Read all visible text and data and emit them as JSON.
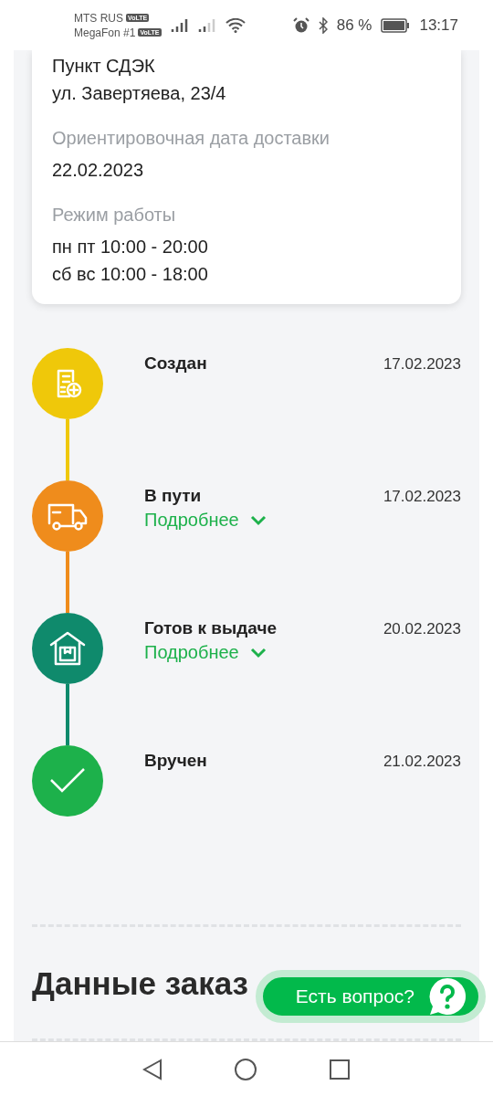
{
  "status_bar": {
    "carriers": [
      {
        "name": "MTS RUS",
        "badge": "VoLTE"
      },
      {
        "name": "MegaFon #1",
        "badge": "VoLTE"
      }
    ],
    "battery": "86 %",
    "time": "13:17"
  },
  "pickup_card": {
    "point": "Пункт СДЭК",
    "address": "ул. Завертяева, 23/4",
    "fields": [
      {
        "label": "Ориентировочная дата доставки",
        "lines": [
          "22.02.2023"
        ]
      },
      {
        "label": "Режим работы",
        "lines": [
          "пн пт 10:00 - 20:00",
          "сб вс 10:00 - 18:00"
        ]
      }
    ]
  },
  "timeline": [
    {
      "kind": "created",
      "title": "Создан",
      "date": "17.02.2023",
      "color": "#efc80a"
    },
    {
      "kind": "transit",
      "title": "В пути",
      "date": "17.02.2023",
      "color": "#ef8c1c",
      "details": "Подробнее",
      "expanded": false
    },
    {
      "kind": "ready",
      "title": "Готов к выдаче",
      "date": "20.02.2023",
      "color": "#0f8a6c",
      "details": "Подробнее",
      "expanded": false
    },
    {
      "kind": "delivered",
      "title": "Вручен",
      "date": "21.02.2023",
      "color": "#1db14b"
    }
  ],
  "order_heading": "Данные заказ",
  "help_button": {
    "label": "Есть вопрос?"
  }
}
